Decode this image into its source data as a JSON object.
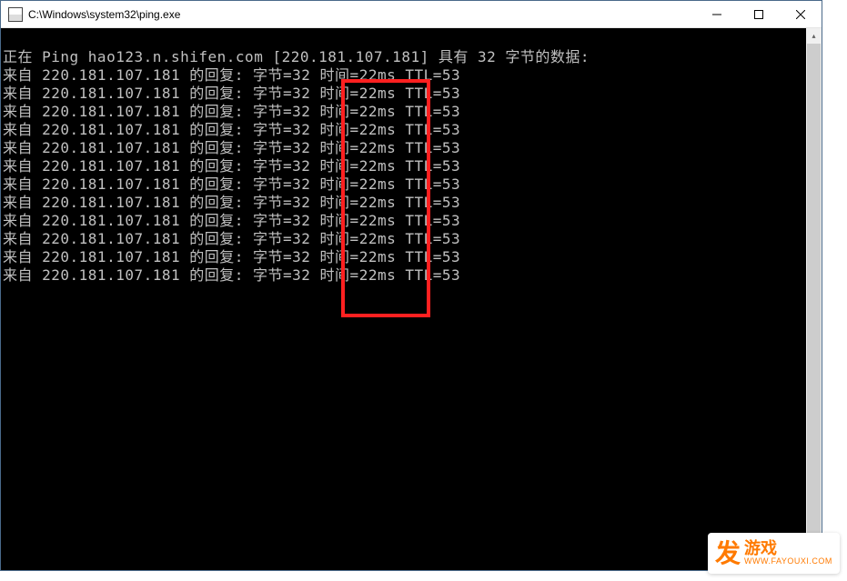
{
  "window": {
    "title": "C:\\Windows\\system32\\ping.exe"
  },
  "console": {
    "header": "正在 Ping hao123.n.shifen.com [220.181.107.181] 具有 32 字节的数据:",
    "replies": [
      {
        "ip": "220.181.107.181",
        "bytes": "32",
        "time": "22ms",
        "ttl": "53"
      },
      {
        "ip": "220.181.107.181",
        "bytes": "32",
        "time": "22ms",
        "ttl": "53"
      },
      {
        "ip": "220.181.107.181",
        "bytes": "32",
        "time": "22ms",
        "ttl": "53"
      },
      {
        "ip": "220.181.107.181",
        "bytes": "32",
        "time": "22ms",
        "ttl": "53"
      },
      {
        "ip": "220.181.107.181",
        "bytes": "32",
        "time": "22ms",
        "ttl": "53"
      },
      {
        "ip": "220.181.107.181",
        "bytes": "32",
        "time": "22ms",
        "ttl": "53"
      },
      {
        "ip": "220.181.107.181",
        "bytes": "32",
        "time": "22ms",
        "ttl": "53"
      },
      {
        "ip": "220.181.107.181",
        "bytes": "32",
        "time": "22ms",
        "ttl": "53"
      },
      {
        "ip": "220.181.107.181",
        "bytes": "32",
        "time": "22ms",
        "ttl": "53"
      },
      {
        "ip": "220.181.107.181",
        "bytes": "32",
        "time": "22ms",
        "ttl": "53"
      },
      {
        "ip": "220.181.107.181",
        "bytes": "32",
        "time": "22ms",
        "ttl": "53"
      },
      {
        "ip": "220.181.107.181",
        "bytes": "32",
        "time": "22ms",
        "ttl": "53"
      }
    ],
    "reply_labels": {
      "from": "来自",
      "reply_of": "的回复:",
      "bytes": "字节",
      "time": "时间",
      "ttl": "TTL"
    }
  },
  "watermark": {
    "logo_main": "发",
    "title": "游戏",
    "url": "WWW.FAYOUXI.COM"
  }
}
